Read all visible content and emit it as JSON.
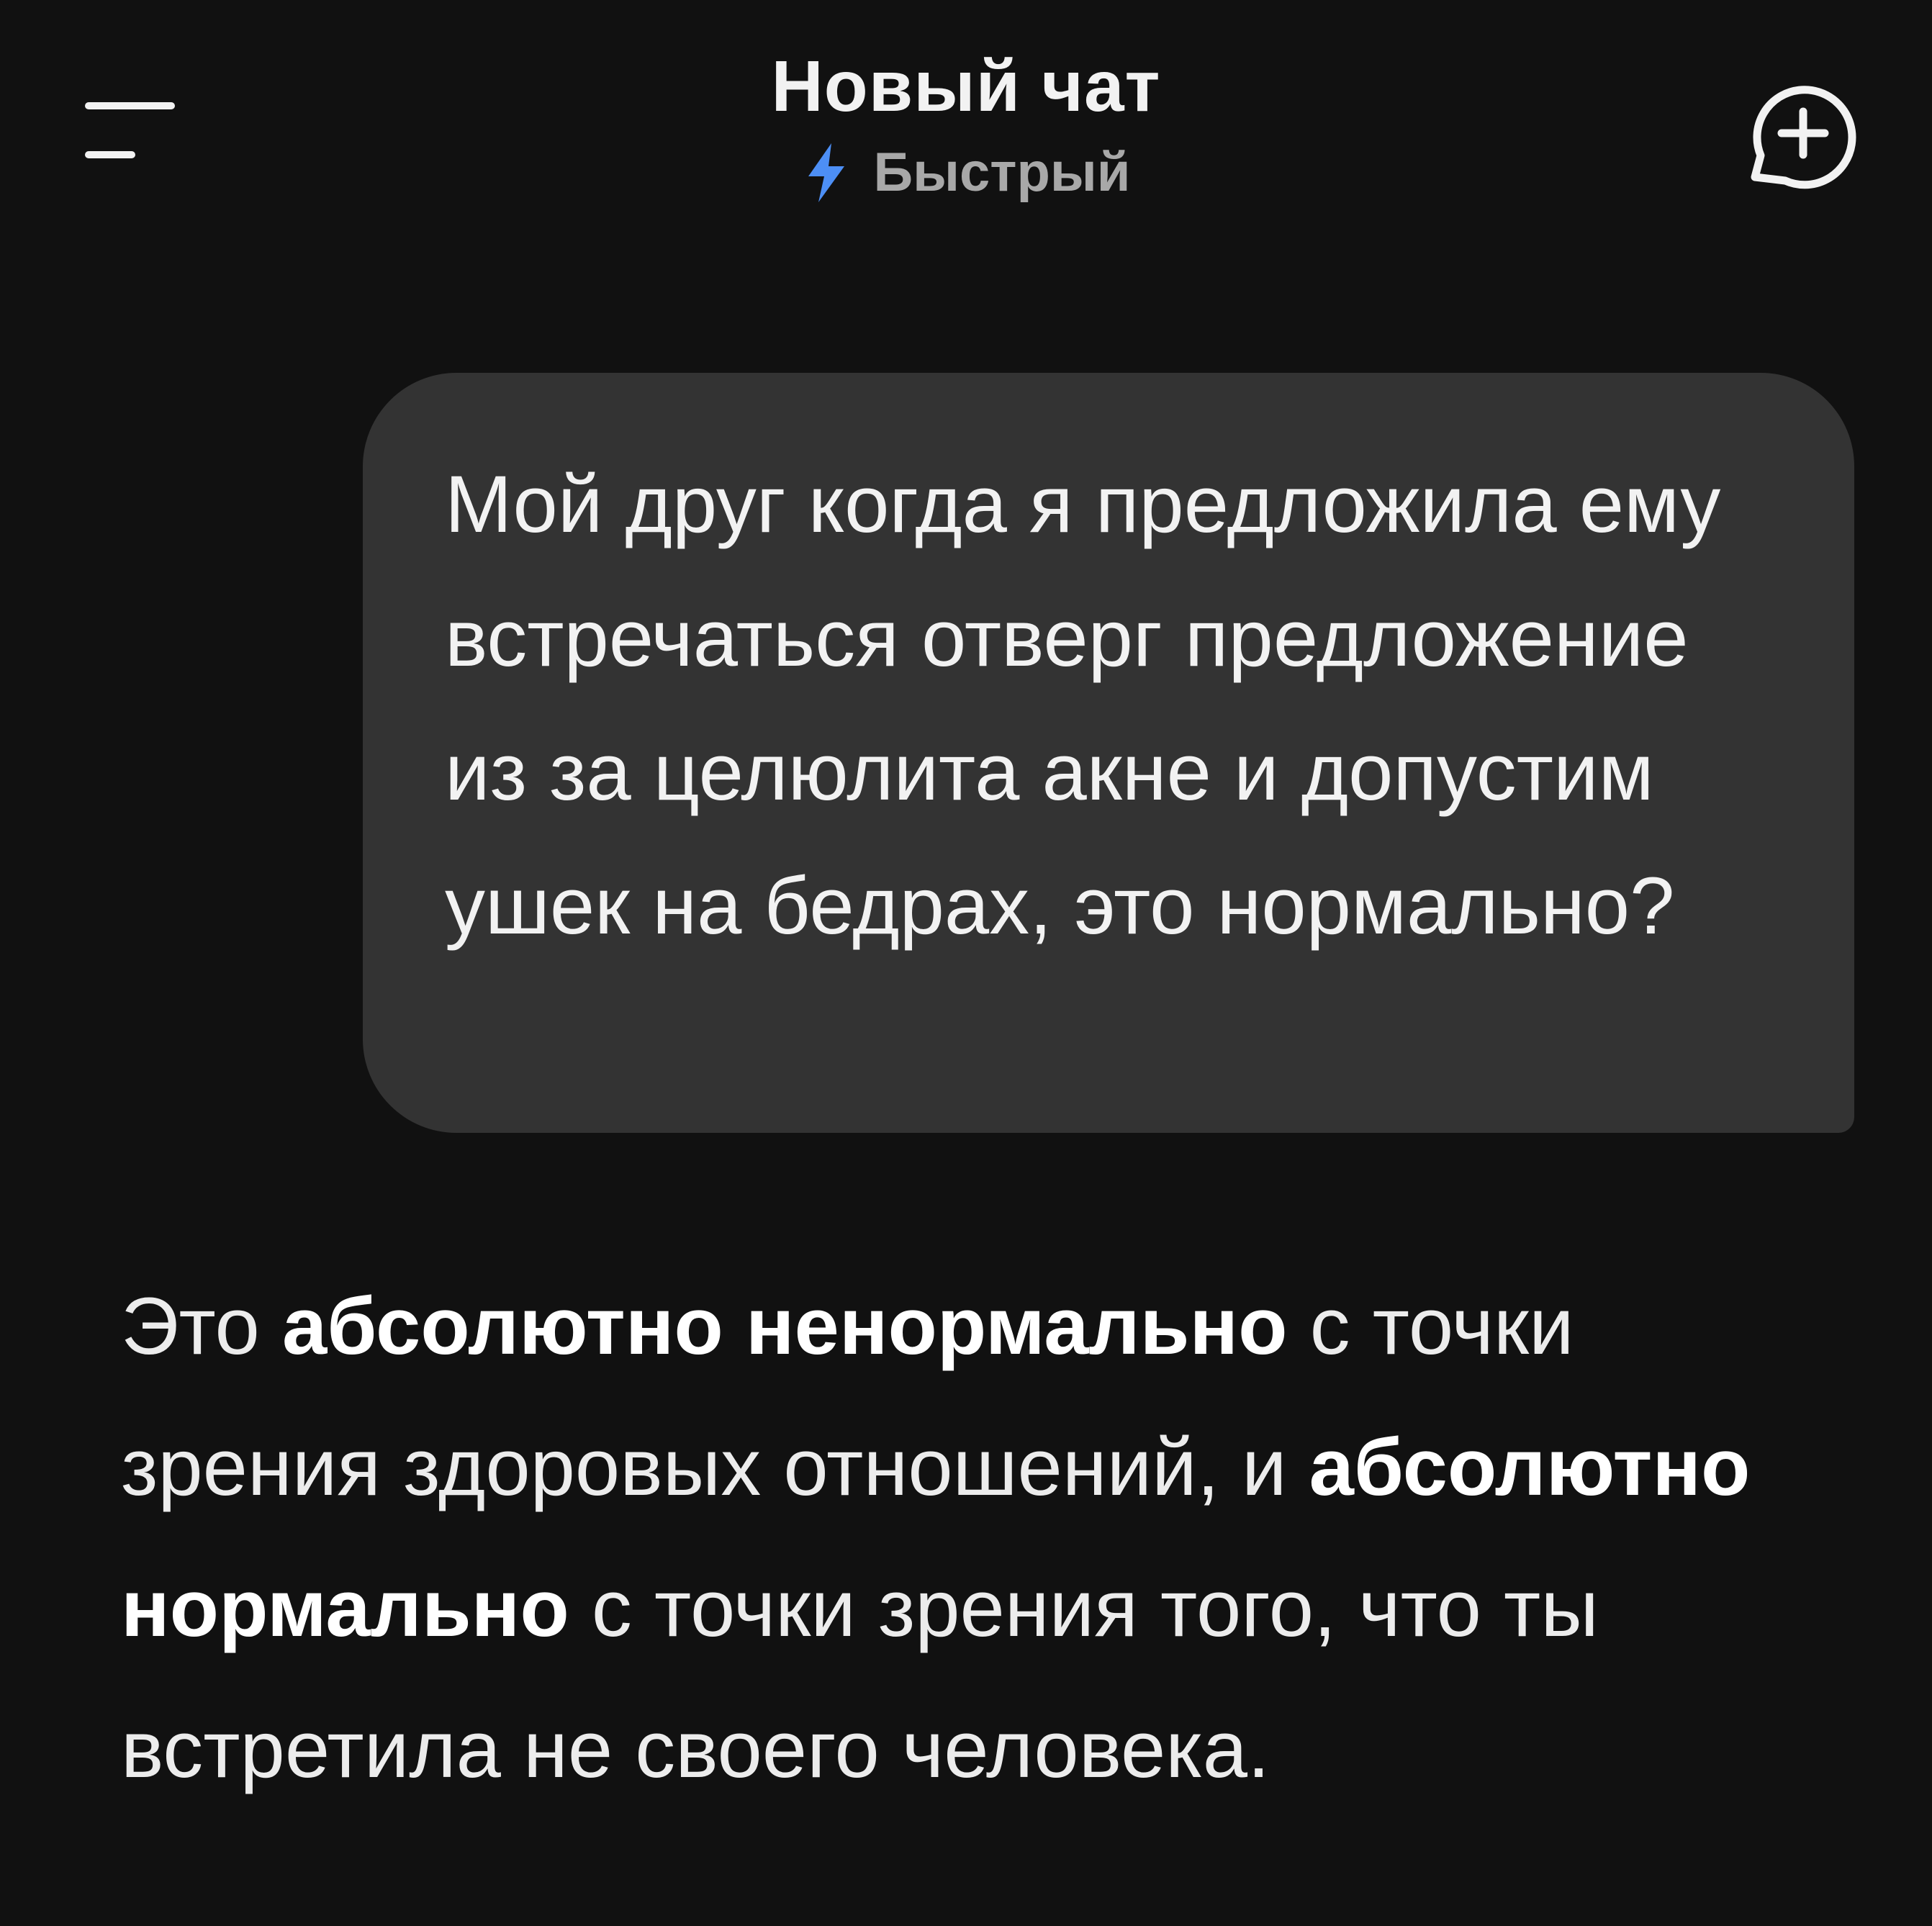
{
  "header": {
    "title": "Новый чат",
    "mode": {
      "label": "Быстрый",
      "icon": "lightning-bolt-icon",
      "icon_color": "#4d8ff5"
    },
    "menu_icon": "menu-icon",
    "new_chat_icon": "new-chat-plus-icon"
  },
  "conversation": {
    "user_message": "Мой друг когда я предложила ему встречаться отверг предложение из за целюлита акне и допустим ушек на бедрах, это нормально?",
    "assistant_message": {
      "part1": "Это ",
      "bold1": "абсолютно ненормально",
      "part2": " с точки зрения здоровых отношений, и ",
      "bold2": "абсолютно нормально",
      "part3": " с точки зрения того, что ты встретила не своего человека."
    }
  },
  "colors": {
    "background": "#111111",
    "user_bubble": "#333333",
    "accent": "#4d8ff5"
  }
}
